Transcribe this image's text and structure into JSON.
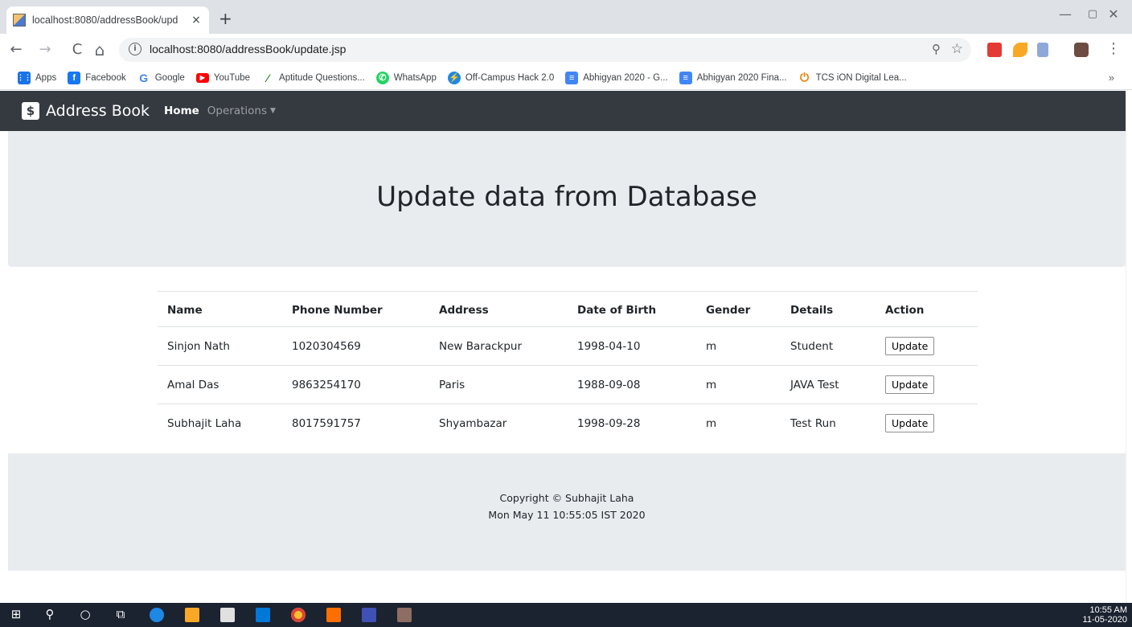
{
  "browser": {
    "tab_title": "localhost:8080/addressBook/upd",
    "tab_close": "×",
    "new_tab": "+",
    "url": "localhost:8080/addressBook/update.jsp",
    "window_controls": {
      "minimize": "—",
      "restore": "▢",
      "close": "✕"
    },
    "nav": {
      "back": "←",
      "forward": "→",
      "reload": "C",
      "home": "⌂"
    },
    "bookmarks": [
      {
        "label": "Apps",
        "icon": "apps-grid-icon",
        "color": "#1a73e8"
      },
      {
        "label": "Facebook",
        "icon": "facebook-icon",
        "color": "#1877f2"
      },
      {
        "label": "Google",
        "icon": "google-icon",
        "color": "#4285f4"
      },
      {
        "label": "YouTube",
        "icon": "youtube-icon",
        "color": "#ff0000"
      },
      {
        "label": "Aptitude Questions...",
        "icon": "aptitude-icon",
        "color": "#3a8d2f"
      },
      {
        "label": "WhatsApp",
        "icon": "whatsapp-icon",
        "color": "#25d366"
      },
      {
        "label": "Off-Campus Hack 2.0",
        "icon": "hackathon-icon",
        "color": "#1e88e5"
      },
      {
        "label": "Abhigyan 2020 - G...",
        "icon": "google-docs-icon",
        "color": "#4285f4"
      },
      {
        "label": "Abhigyan 2020 Fina...",
        "icon": "google-docs-icon",
        "color": "#4285f4"
      },
      {
        "label": "TCS iON Digital Lea...",
        "icon": "tcs-ion-icon",
        "color": "#f57c00"
      }
    ],
    "bookmarks_more": "»"
  },
  "navbar": {
    "logo_glyph": "$",
    "brand": "Address Book",
    "home": "Home",
    "operations": "Operations",
    "caret": "▼"
  },
  "page": {
    "heading": "Update data from Database"
  },
  "table": {
    "headers": [
      "Name",
      "Phone Number",
      "Address",
      "Date of Birth",
      "Gender",
      "Details",
      "Action"
    ],
    "rows": [
      {
        "name": "Sinjon Nath",
        "phone": "1020304569",
        "address": "New Barackpur",
        "dob": "1998-04-10",
        "gender": "m",
        "details": "Student",
        "action": "Update"
      },
      {
        "name": "Amal Das",
        "phone": "9863254170",
        "address": "Paris",
        "dob": "1988-09-08",
        "gender": "m",
        "details": "JAVA Test",
        "action": "Update"
      },
      {
        "name": "Subhajit Laha",
        "phone": "8017591757",
        "address": "Shyambazar",
        "dob": "1998-09-28",
        "gender": "m",
        "details": "Test Run",
        "action": "Update"
      }
    ]
  },
  "footer": {
    "copyright": "Copyright © Subhajit Laha",
    "timestamp": "Mon May 11 10:55:05 IST 2020"
  },
  "taskbar": {
    "time": "10:55 AM",
    "date": "11-05-2020"
  },
  "colors": {
    "navbar_bg": "#343a40",
    "jumbotron_bg": "#e9ecef",
    "taskbar_bg": "#1b2230"
  }
}
